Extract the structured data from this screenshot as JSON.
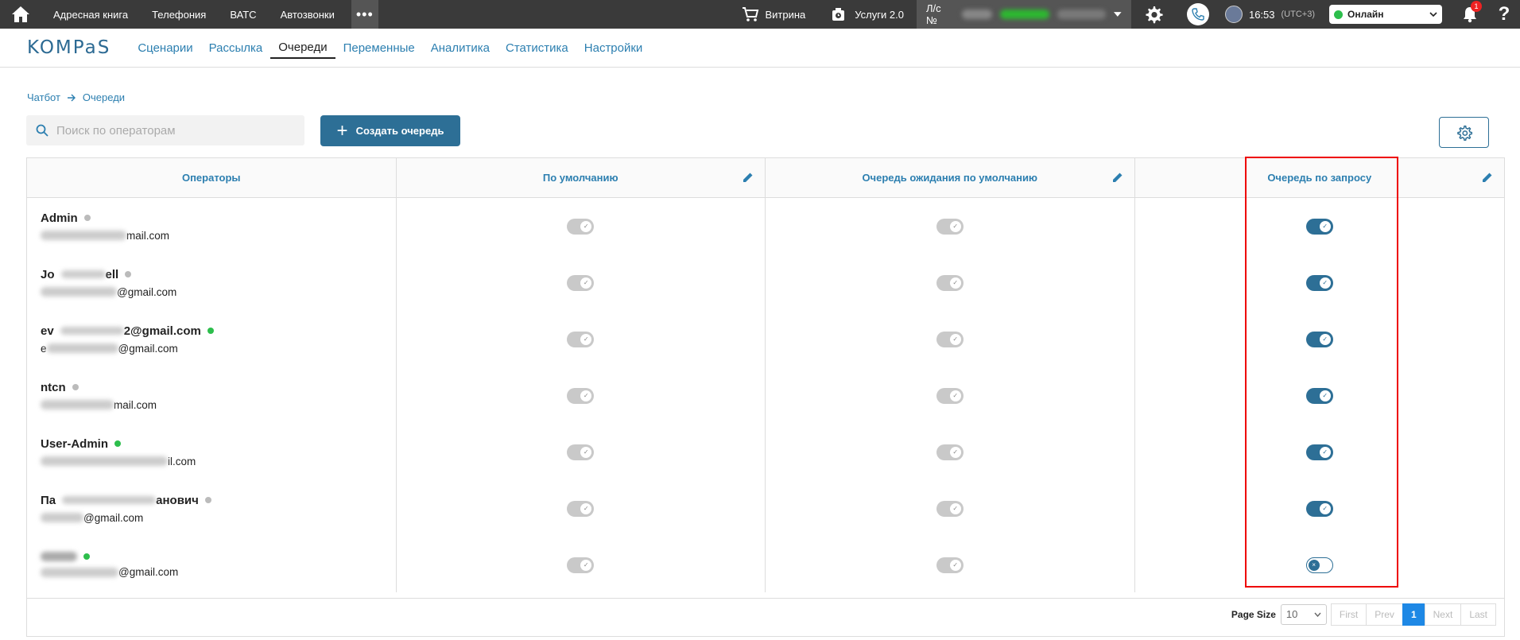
{
  "topbar": {
    "nav": [
      "Адресная книга",
      "Телефония",
      "ВАТС",
      "Автозвонки"
    ],
    "more_label": "•••",
    "showcase_label": "Витрина",
    "services_label": "Услуги 2.0",
    "account_label": "Л/с №",
    "time": "16:53",
    "timezone": "(UTC+3)",
    "status": "Онлайн",
    "notifications_count": "1",
    "help_label": "?"
  },
  "subnav": {
    "logo": "KOMPaS",
    "items": [
      "Сценарии",
      "Рассылка",
      "Очереди",
      "Переменные",
      "Аналитика",
      "Статистика",
      "Настройки"
    ],
    "active": "Очереди"
  },
  "breadcrumb": {
    "items": [
      "Чатбот",
      "Очереди"
    ]
  },
  "search": {
    "placeholder": "Поиск по операторам",
    "value": ""
  },
  "create_button": "Создать очередь",
  "table": {
    "headers": [
      "Операторы",
      "По умолчанию",
      "Очередь ожидания по умолчанию",
      "Очередь по запросу"
    ],
    "rows": [
      {
        "name_visible": "Admin",
        "mail_visible": "mail.com",
        "status": "offline",
        "default": "off",
        "wait": "off",
        "request": "on"
      },
      {
        "name_visible": "Jo",
        "name_tail": "ell",
        "mail_visible": "@gmail.com",
        "status": "offline",
        "default": "off",
        "wait": "off",
        "request": "on"
      },
      {
        "name_visible": "ev",
        "name_tail": "2@gmail.com",
        "mail_prefix": "e",
        "mail_visible": "@gmail.com",
        "status": "online",
        "default": "off",
        "wait": "off",
        "request": "on"
      },
      {
        "name_visible": "ntcn",
        "mail_visible": "mail.com",
        "status": "offline",
        "default": "off",
        "wait": "off",
        "request": "on"
      },
      {
        "name_visible": "User-Admin",
        "mail_visible": "il.com",
        "status": "online",
        "default": "off",
        "wait": "off",
        "request": "on"
      },
      {
        "name_visible": "Па",
        "name_tail": "анович",
        "mail_visible": "@gmail.com",
        "status": "offline",
        "default": "off",
        "wait": "off",
        "request": "on"
      },
      {
        "name_visible": "",
        "mail_visible": "@gmail.com",
        "status": "online",
        "default": "off",
        "wait": "off",
        "request": "off"
      }
    ]
  },
  "pagination": {
    "page_size_label": "Page Size",
    "page_size": "10",
    "first": "First",
    "prev": "Prev",
    "current": "1",
    "next": "Next",
    "last": "Last"
  },
  "colors": {
    "accent": "#2d6f96",
    "link": "#2c7fb0",
    "highlight": "#e00000"
  }
}
